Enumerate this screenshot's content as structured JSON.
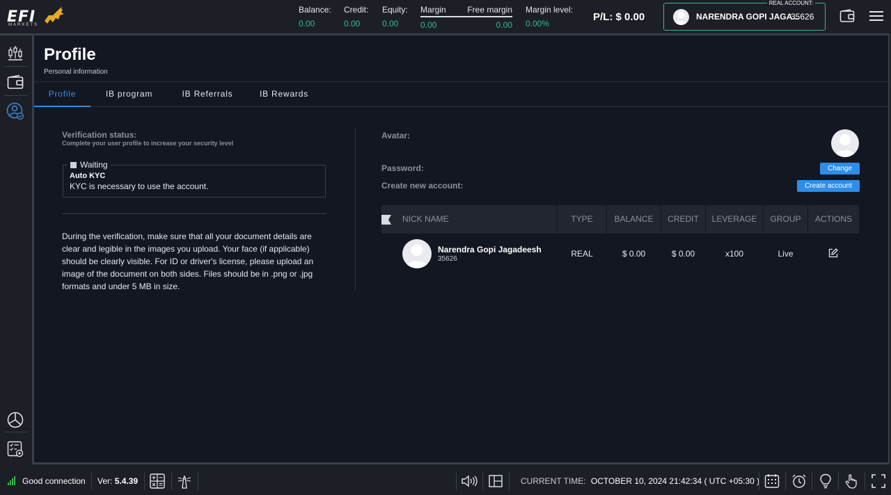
{
  "header": {
    "logo_text": "EFI",
    "logo_sub": "MARKETS",
    "stats": {
      "balance": {
        "label": "Balance:",
        "value": "0.00"
      },
      "credit": {
        "label": "Credit:",
        "value": "0.00"
      },
      "equity": {
        "label": "Equity:",
        "value": "0.00"
      },
      "margin": {
        "label": "Margin",
        "value": "0.00"
      },
      "free_margin": {
        "label": "Free margin",
        "value": "0.00"
      },
      "margin_level": {
        "label": "Margin level:",
        "value": "0.00%"
      }
    },
    "pl_label": "P/L:",
    "pl_value": "$ 0.00",
    "account": {
      "type_label": "REAL ACCOUNT:",
      "name": "NARENDRA GOPI JAGA...",
      "number": "35626"
    }
  },
  "page": {
    "title": "Profile",
    "subtitle": "Personal information",
    "tabs": [
      {
        "label": "Profile",
        "active": true
      },
      {
        "label": "IB program",
        "active": false
      },
      {
        "label": "IB Referrals",
        "active": false
      },
      {
        "label": "IB Rewards",
        "active": false
      }
    ]
  },
  "verification": {
    "title": "Verification status:",
    "subtitle": "Complete your user profile to increase your security level",
    "status": "Waiting",
    "kyc_name": "Auto KYC",
    "kyc_desc": "KYC is necessary to use the account.",
    "instructions": "During the verification, make sure that all your document details are clear and legible in the images you upload. Your face (if applicable) should be clearly visible. For ID or driver's license, please upload an image of the document on both sides. Files should be in .png or .jpg formats and under 5 MB in size."
  },
  "profile": {
    "avatar_label": "Avatar:",
    "password_label": "Password:",
    "create_label": "Create new account:",
    "change_button": "Change",
    "create_button": "Create account"
  },
  "accounts_table": {
    "headers": {
      "nick": "NICK NAME",
      "type": "TYPE",
      "balance": "BALANCE",
      "credit": "CREDIT",
      "leverage": "LEVERAGE",
      "group": "GROUP",
      "actions": "ACTIONS"
    },
    "rows": [
      {
        "name": "Narendra Gopi Jagadeesh",
        "number": "35626",
        "type": "REAL",
        "balance": "$ 0.00",
        "credit": "$ 0.00",
        "leverage": "x100",
        "group": "Live"
      }
    ]
  },
  "footer": {
    "connection": "Good connection",
    "version_label": "Ver:",
    "version": "5.4.39",
    "current_time_label": "CURRENT TIME:",
    "current_time": "OCTOBER 10, 2024 21:42:34 ( UTC +05:30 )"
  },
  "colors": {
    "accent": "#2e8de8",
    "positive": "#37b89a",
    "background": "#131722"
  }
}
